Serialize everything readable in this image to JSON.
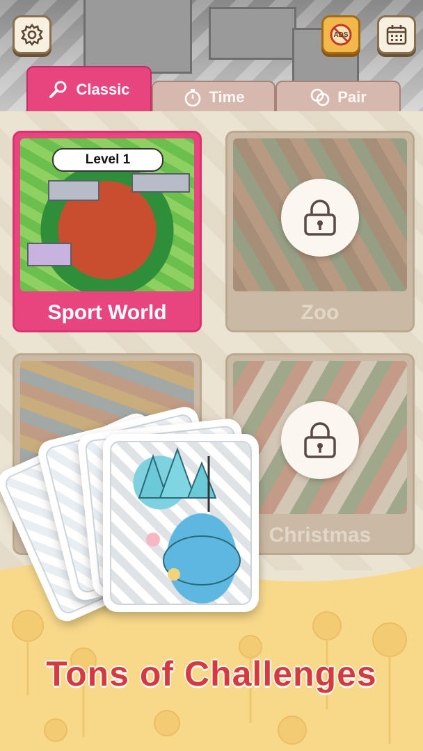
{
  "header": {
    "settings_icon": "gear-icon",
    "ads_label": "ADS",
    "ads_icon": "no-ads-icon",
    "calendar_icon": "calendar-icon"
  },
  "tabs": [
    {
      "label": "Classic",
      "icon": "magnifier-icon",
      "active": true
    },
    {
      "label": "Time",
      "icon": "stopwatch-icon",
      "active": false
    },
    {
      "label": "Pair",
      "icon": "pair-circles-icon",
      "active": false
    }
  ],
  "levels": [
    {
      "name": "Sport World",
      "badge": "Level 1",
      "locked": false
    },
    {
      "name": "Zoo",
      "locked": true
    },
    {
      "name": "",
      "locked": true
    },
    {
      "name": "Christmas",
      "locked": true
    }
  ],
  "promo": {
    "headline": "Tons of Challenges"
  },
  "colors": {
    "accent_pink": "#e8457f",
    "headline_red": "#d63a3f",
    "ads_orange": "#f2b84a"
  }
}
